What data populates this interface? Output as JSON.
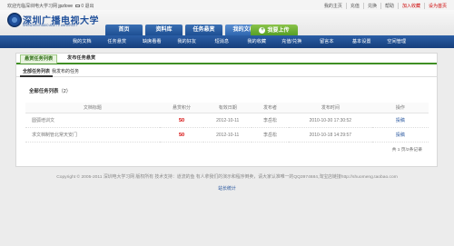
{
  "topbar": {
    "welcome": "欢迎光临深圳电大学习网",
    "user": "jpzlove",
    "mail_count": "0",
    "logout": "退出",
    "links": [
      "我的主页",
      "充值",
      "兑换",
      "帮助",
      "加入收藏",
      "设为首页"
    ]
  },
  "logo": {
    "name_cn": "深圳广播电视大学",
    "name_en": "SHENZHEN RADIO AND TV UNIVERSITY"
  },
  "main_tabs": [
    "首页",
    "资料库",
    "任务悬赏",
    "我的文档"
  ],
  "upload_label": "我要上传",
  "nav_items": [
    "我的文档",
    "任务悬赏",
    "缺席看看",
    "我的好友",
    "短消息",
    "我的收藏",
    "充值/兑换",
    "留言本",
    "基本设置",
    "空间管理"
  ],
  "panel": {
    "tab_primary": "悬赏任务列表",
    "tab_secondary": "发布任务悬赏",
    "subtab_all": "全部任务列表",
    "subtab_mine": "我发布的任务",
    "section_title": "全部任务列表",
    "section_count": "（2）",
    "columns": [
      "文档标题",
      "悬赏积分",
      "有效日期",
      "发布者",
      "发布时间",
      "操作"
    ],
    "rows": [
      {
        "title": "圆弧培训文",
        "points": "50",
        "valid": "2012-10-11",
        "author": "李岳松",
        "time": "2010-10-30 17:30:52",
        "action": "投稿"
      },
      {
        "title": "求文档制管北常天安门",
        "points": "50",
        "valid": "2012-10-11",
        "author": "李岳松",
        "time": "2010-10-18 14:29:57",
        "action": "投稿"
      }
    ],
    "pager": "共 1 页/2条记录"
  },
  "footer": {
    "copyright": "Copyright © 2005-2011 深圳电大学习网 版权所有 技术支持：道流的鱼 有人拿我们的演示和程序倒卖，请大家认准唯一的QQ3974684,淘宝店链接http://shuomeng.taobao.com",
    "stats": "站长统计"
  },
  "colors": {
    "nav_blue": "#1f4f9a",
    "accent_green": "#3f8f24",
    "points_red": "#d40000"
  }
}
